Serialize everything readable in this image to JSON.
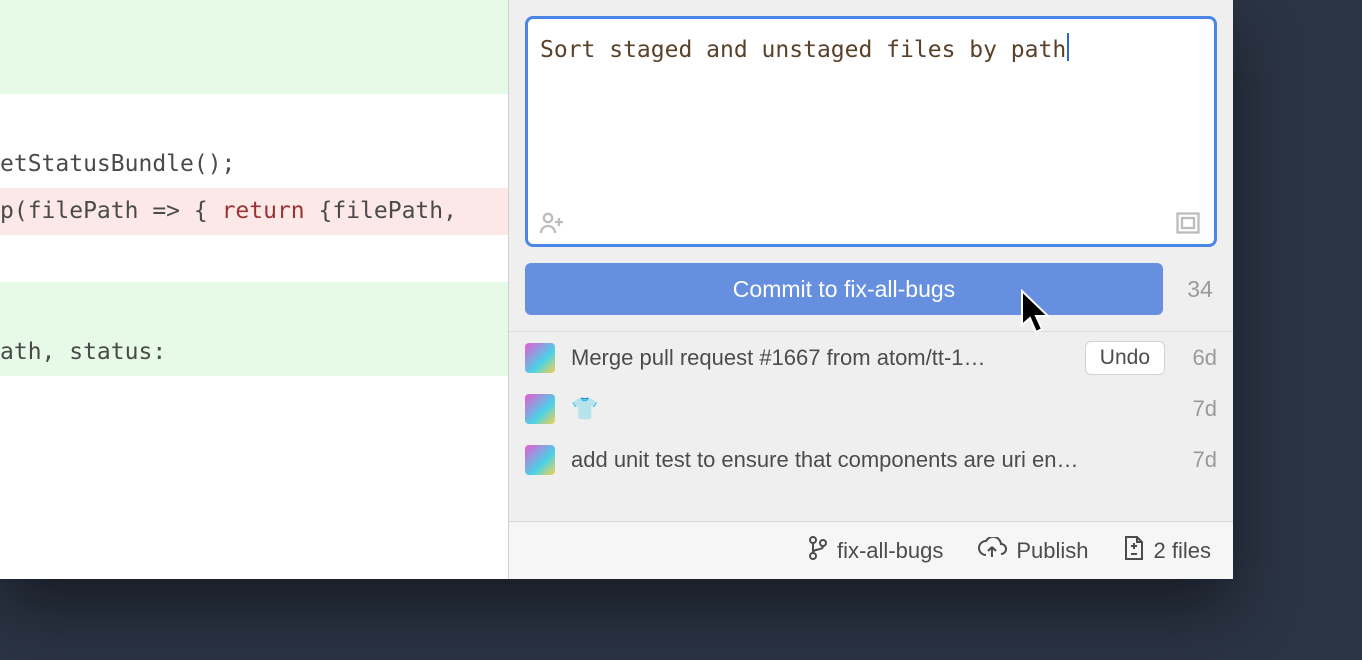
{
  "diff": {
    "lines": [
      {
        "type": "add",
        "text": ""
      },
      {
        "type": "add",
        "text": ""
      },
      {
        "type": "blank",
        "text": ""
      },
      {
        "type": "blank",
        "text": "etStatusBundle();"
      },
      {
        "type": "del",
        "text": "p(filePath => { return {filePath,"
      },
      {
        "type": "blank",
        "text": ""
      },
      {
        "type": "add",
        "text": ""
      },
      {
        "type": "add",
        "text": "ath, status:"
      },
      {
        "type": "blank",
        "text": ""
      }
    ]
  },
  "commit": {
    "message": "Sort staged and unstaged files by path",
    "submit_label": "Commit to fix-all-bugs",
    "char_count": "34"
  },
  "recent": [
    {
      "message": "Merge pull request #1667 from atom/tt-1…",
      "undo": "Undo",
      "time": "6d"
    },
    {
      "message": "👕",
      "time": "7d"
    },
    {
      "message": "add unit test to ensure that components are uri en…",
      "time": "7d"
    }
  ],
  "statusbar": {
    "branch": "fix-all-bugs",
    "publish": "Publish",
    "files": "2 files"
  }
}
